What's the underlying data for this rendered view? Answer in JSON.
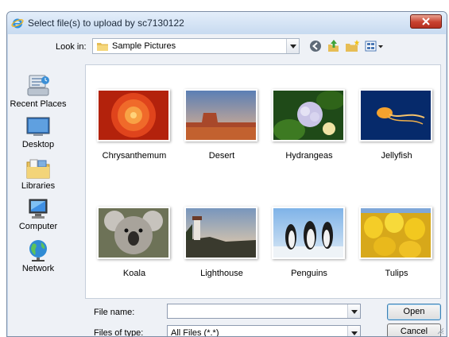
{
  "window": {
    "title": "Select file(s) to upload by sc7130122"
  },
  "look_in": {
    "label": "Look in:",
    "value": "Sample Pictures"
  },
  "toolbar": {
    "icons": [
      "back-icon",
      "up-folder-icon",
      "new-folder-icon",
      "view-menu-icon"
    ]
  },
  "places": [
    {
      "label": "Recent Places",
      "icon": "recent-places-icon"
    },
    {
      "label": "Desktop",
      "icon": "desktop-icon"
    },
    {
      "label": "Libraries",
      "icon": "libraries-icon"
    },
    {
      "label": "Computer",
      "icon": "computer-icon"
    },
    {
      "label": "Network",
      "icon": "network-icon"
    }
  ],
  "files": [
    {
      "name": "Chrysanthemum"
    },
    {
      "name": "Desert"
    },
    {
      "name": "Hydrangeas"
    },
    {
      "name": "Jellyfish"
    },
    {
      "name": "Koala"
    },
    {
      "name": "Lighthouse"
    },
    {
      "name": "Penguins"
    },
    {
      "name": "Tulips"
    }
  ],
  "file_name": {
    "label": "File name:",
    "value": ""
  },
  "file_type": {
    "label": "Files of type:",
    "value": "All Files (*.*)"
  },
  "buttons": {
    "open": "Open",
    "cancel": "Cancel"
  },
  "colors": {
    "title_bar": "#c7daf0",
    "close_button": "#c8412f",
    "panel": "#eef1f6"
  }
}
